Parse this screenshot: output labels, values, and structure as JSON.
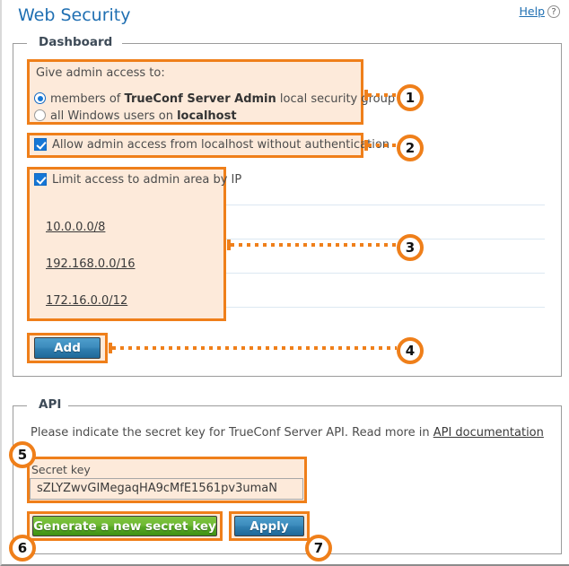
{
  "header": {
    "title": "Web Security",
    "help_label": "Help",
    "help_icon": "question-circle-icon"
  },
  "dashboard": {
    "legend": "Dashboard",
    "admin_access_label": "Give admin access to:",
    "radio_options": [
      {
        "id": "group-members",
        "selected": true,
        "text_before": "members of ",
        "text_bold": "TrueConf Server Admin",
        "text_after": " local security group"
      },
      {
        "id": "all-windows-users",
        "selected": false,
        "text_before": "all Windows users on ",
        "text_bold": "localhost",
        "text_after": ""
      }
    ],
    "allow_localhost_checkbox": {
      "checked": true,
      "label": "Allow admin access from localhost without authentication"
    },
    "limit_ip_checkbox": {
      "checked": true,
      "label": "Limit access to admin area by IP"
    },
    "ip_list": [
      "10.0.0.0/8",
      "192.168.0.0/16",
      "172.16.0.0/12"
    ],
    "add_button": "Add"
  },
  "api": {
    "legend": "API",
    "description_before": "Please indicate the secret key for TrueConf Server API. Read more in ",
    "documentation_link": "API documentation",
    "secret_key_label": "Secret key",
    "secret_key_value": "sZLYZwvGIMegaqHA9cMfE1561pv3umaN",
    "generate_button": "Generate a new secret key",
    "apply_button": "Apply"
  },
  "callouts": [
    {
      "number": "1"
    },
    {
      "number": "2"
    },
    {
      "number": "3"
    },
    {
      "number": "4"
    },
    {
      "number": "5"
    },
    {
      "number": "6"
    },
    {
      "number": "7"
    }
  ],
  "colors": {
    "accent_orange": "#ef7f1a",
    "highlight_fill": "#fdeada",
    "link_blue": "#1f6fb2",
    "button_blue": "#2f7eb0",
    "button_green": "#58a826"
  }
}
